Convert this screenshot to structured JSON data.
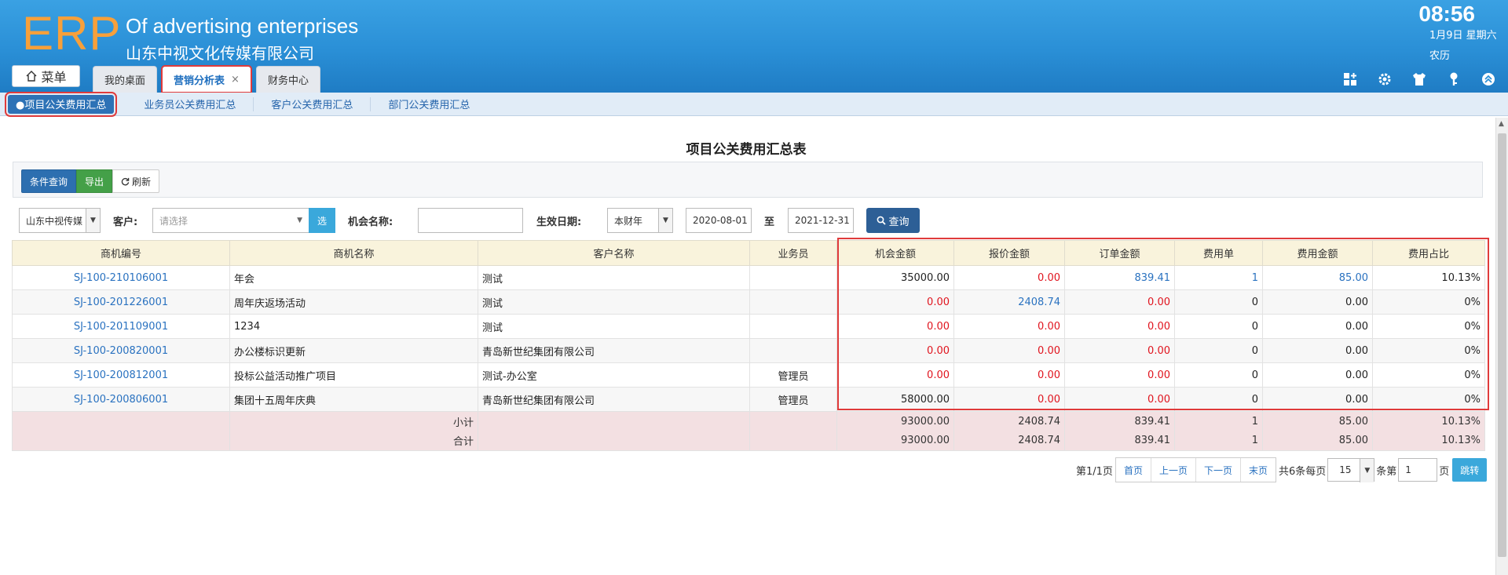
{
  "header": {
    "logo": "ERP",
    "brand_en": "Of advertising enterprises",
    "brand_cn": "山东中视文化传媒有限公司",
    "time": "08:56",
    "date": "1月9日 星期六",
    "lunar": "农历",
    "menu_label": "菜单"
  },
  "tabs": [
    {
      "label": "我的桌面"
    },
    {
      "label": "营销分析表",
      "close": "×"
    },
    {
      "label": "财务中心"
    }
  ],
  "subnav": [
    "●项目公关费用汇总",
    "业务员公关费用汇总",
    "客户公关费用汇总",
    "部门公关费用汇总"
  ],
  "title": "项目公关费用汇总表",
  "toolbar": {
    "query": "条件查询",
    "export": "导出",
    "refresh": "刷新"
  },
  "filters": {
    "company": "山东中视传媒",
    "customer_label": "客户:",
    "customer_placeholder": "请选择",
    "select_btn": "选",
    "opp_label": "机会名称:",
    "opp_value": "",
    "date_label": "生效日期:",
    "period": "本财年",
    "date_from": "2020-08-01",
    "to": "至",
    "date_to": "2021-12-31",
    "query_btn": "查询"
  },
  "table": {
    "headers": [
      "商机编号",
      "商机名称",
      "客户名称",
      "业务员",
      "机会金额",
      "报价金额",
      "订单金额",
      "费用单",
      "费用金额",
      "费用占比"
    ],
    "rows": [
      [
        "SJ-100-210106001",
        "年会",
        "测试",
        "",
        "35000.00",
        "0.00",
        "839.41",
        "1",
        "85.00",
        "10.13%"
      ],
      [
        "SJ-100-201226001",
        "周年庆返场活动",
        "测试",
        "",
        "0.00",
        "2408.74",
        "0.00",
        "0",
        "0.00",
        "0%"
      ],
      [
        "SJ-100-201109001",
        "1234",
        "测试",
        "",
        "0.00",
        "0.00",
        "0.00",
        "0",
        "0.00",
        "0%"
      ],
      [
        "SJ-100-200820001",
        "办公楼标识更新",
        "青岛新世纪集团有限公司",
        "",
        "0.00",
        "0.00",
        "0.00",
        "0",
        "0.00",
        "0%"
      ],
      [
        "SJ-100-200812001",
        "投标公益活动推广项目",
        "测试-办公室",
        "管理员",
        "0.00",
        "0.00",
        "0.00",
        "0",
        "0.00",
        "0%"
      ],
      [
        "SJ-100-200806001",
        "集团十五周年庆典",
        "青岛新世纪集团有限公司",
        "管理员",
        "58000.00",
        "0.00",
        "0.00",
        "0",
        "0.00",
        "0%"
      ]
    ],
    "subtotal": [
      "小计",
      "93000.00",
      "2408.74",
      "839.41",
      "1",
      "85.00",
      "10.13%"
    ],
    "total": [
      "合计",
      "93000.00",
      "2408.74",
      "839.41",
      "1",
      "85.00",
      "10.13%"
    ]
  },
  "pager": {
    "info": "第1/1页",
    "first": "首页",
    "prev": "上一页",
    "next": "下一页",
    "last": "末页",
    "count": "共6条每页",
    "page_size": "15",
    "goto_pre": "条第",
    "page": "1",
    "goto_post": "页",
    "jump": "跳转"
  },
  "colors": {
    "accent": "#2d72b6",
    "red": "#e0141e",
    "link": "#2a72c0",
    "logo": "#f7a03a"
  }
}
